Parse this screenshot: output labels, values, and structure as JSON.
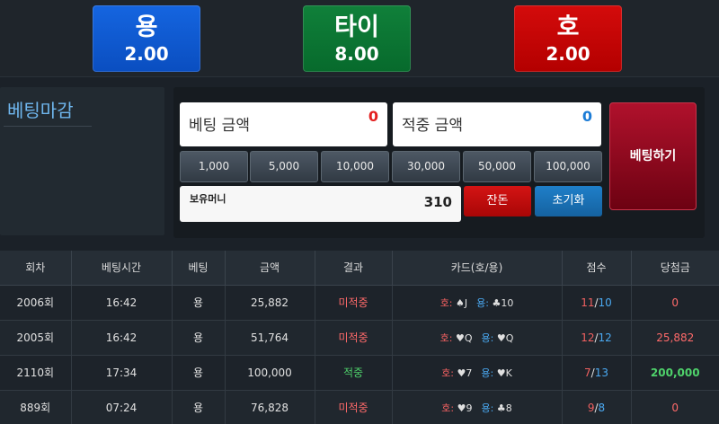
{
  "odds": [
    {
      "name": "용",
      "value": "2.00"
    },
    {
      "name": "타이",
      "value": "8.00"
    },
    {
      "name": "호",
      "value": "2.00"
    }
  ],
  "status": {
    "title": "베팅마감"
  },
  "bet": {
    "bet_label": "베팅 금액",
    "bet_value": "0",
    "win_label": "적중 금액",
    "win_value": "0",
    "chips": [
      "1,000",
      "5,000",
      "10,000",
      "30,000",
      "50,000",
      "100,000"
    ],
    "balance_label": "보유머니",
    "balance_value": "310",
    "remain_label": "잔돈",
    "reset_label": "초기화",
    "submit_label": "베팅하기"
  },
  "table": {
    "headers": [
      "회차",
      "베팅시간",
      "베팅",
      "금액",
      "결과",
      "카드(호/용)",
      "점수",
      "당첨금"
    ],
    "rows": [
      {
        "round": "2006회",
        "time": "16:42",
        "pick": "용",
        "amount": "25,882",
        "result": "미적중",
        "result_type": "lose",
        "tiger_label": "호:",
        "tiger_card": "♠J",
        "dragon_label": "용:",
        "dragon_card": "♣10",
        "score_a": "11",
        "score_b": "10",
        "payout": "0",
        "payout_type": "zero"
      },
      {
        "round": "2005회",
        "time": "16:42",
        "pick": "용",
        "amount": "51,764",
        "result": "미적중",
        "result_type": "lose",
        "tiger_label": "호:",
        "tiger_card": "♥Q",
        "dragon_label": "용:",
        "dragon_card": "♥Q",
        "score_a": "12",
        "score_b": "12",
        "payout": "25,882",
        "payout_type": "red"
      },
      {
        "round": "2110회",
        "time": "17:34",
        "pick": "용",
        "amount": "100,000",
        "result": "적중",
        "result_type": "win",
        "tiger_label": "호:",
        "tiger_card": "♥7",
        "dragon_label": "용:",
        "dragon_card": "♥K",
        "score_a": "7",
        "score_b": "13",
        "payout": "200,000",
        "payout_type": "green"
      },
      {
        "round": "889회",
        "time": "07:24",
        "pick": "용",
        "amount": "76,828",
        "result": "미적중",
        "result_type": "lose",
        "tiger_label": "호:",
        "tiger_card": "♥9",
        "dragon_label": "용:",
        "dragon_card": "♣8",
        "score_a": "9",
        "score_b": "8",
        "payout": "0",
        "payout_type": "zero"
      }
    ]
  },
  "colors": {
    "dragon": "#0a4ec0",
    "tie": "#076a2c",
    "tiger": "#b30000",
    "status_title": "#6fb6ee",
    "lose": "#ff6a6a",
    "win": "#4fd36b"
  }
}
